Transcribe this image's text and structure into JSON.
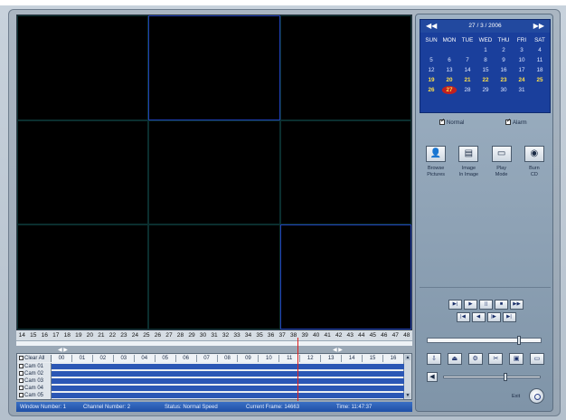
{
  "calendar": {
    "title": "27 / 3  / 2006",
    "prev_icon": "rewind-icon",
    "next_icon": "fast-forward-icon",
    "weekdays": [
      "SUN",
      "MON",
      "TUE",
      "WED",
      "THU",
      "FRI",
      "SAT"
    ],
    "weeks": [
      [
        "",
        "",
        "",
        "1",
        "2",
        "3",
        "4"
      ],
      [
        "5",
        "6",
        "7",
        "8",
        "9",
        "10",
        "11"
      ],
      [
        "12",
        "13",
        "14",
        "15",
        "16",
        "17",
        "18"
      ],
      [
        "19",
        "20",
        "21",
        "22",
        "23",
        "24",
        "25"
      ],
      [
        "26",
        "27",
        "28",
        "29",
        "30",
        "31",
        ""
      ]
    ],
    "selected_day": "27",
    "highlight_row": 3,
    "highlight_color": "#ffe04a",
    "today_color": "#c12020"
  },
  "options": {
    "normal_label": "Normal",
    "alarm_label": "Alarm"
  },
  "tools": [
    {
      "label1": "Browse",
      "label2": "Pictures",
      "icon": "person-icon"
    },
    {
      "label1": "Image",
      "label2": "In Image",
      "icon": "pip-icon"
    },
    {
      "label1": "Play",
      "label2": "Mode",
      "icon": "window-icon"
    },
    {
      "label1": "Burn",
      "label2": "CD",
      "icon": "disc-icon"
    }
  ],
  "playback": {
    "row1": [
      "▶|",
      "▶",
      "||",
      "■",
      "▶▶"
    ],
    "row2": [
      "|◀",
      "◀",
      "|▶",
      "▶|"
    ]
  },
  "speed_level": 0.82,
  "volume_level": 0.65,
  "tools2": [
    "⇩",
    "⏏",
    "⚙",
    "✂",
    "▣",
    "▭"
  ],
  "exit_label": "Exit",
  "timeline": {
    "hours": [
      "14",
      "15",
      "16",
      "17",
      "18",
      "19",
      "20",
      "21",
      "22",
      "23",
      "24",
      "25",
      "26",
      "27",
      "28",
      "29",
      "30",
      "31",
      "32",
      "33",
      "34",
      "35",
      "36",
      "37",
      "38",
      "39",
      "40",
      "41",
      "42",
      "43",
      "44",
      "45",
      "46",
      "47",
      "48"
    ],
    "cursor_position": 0.71
  },
  "channels": {
    "header_label": "Clear All",
    "columns": [
      "00",
      "01",
      "02",
      "03",
      "04",
      "05",
      "06",
      "07",
      "08",
      "09",
      "10",
      "11",
      "12",
      "13",
      "14",
      "15",
      "16"
    ],
    "rows": [
      "Cam 01",
      "Cam 02",
      "Cam 03",
      "Cam 04",
      "Cam 05"
    ]
  },
  "status": {
    "window_number": "Window Number: 1",
    "channel_number": "Channel Number: 2",
    "status_text": "Status: Normal Speed",
    "current_frame": "Current Frame: 14663",
    "time": "Time: 11:47:37"
  },
  "colors": {
    "accent": "#1a3f9c",
    "track": "#2b57b5",
    "cursor": "#e02020"
  }
}
